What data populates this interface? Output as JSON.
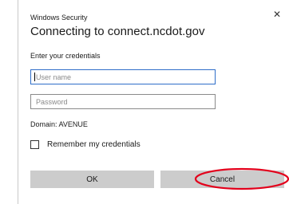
{
  "window": {
    "app_title": "Windows Security",
    "close_glyph": "✕"
  },
  "dialog": {
    "heading": "Connecting to connect.ncdot.gov",
    "prompt": "Enter your credentials",
    "username": {
      "placeholder": "User name",
      "value": ""
    },
    "password": {
      "placeholder": "Password",
      "value": ""
    },
    "domain_text": "Domain: AVENUE",
    "remember_label": "Remember my credentials",
    "remember_checked": false,
    "ok_label": "OK",
    "cancel_label": "Cancel"
  },
  "colors": {
    "focus_border": "#2f6ec9",
    "button_bg": "#cccccc",
    "annotation": "#e3001b"
  },
  "icons": {
    "close": "close-icon",
    "checkbox": "checkbox-icon"
  }
}
